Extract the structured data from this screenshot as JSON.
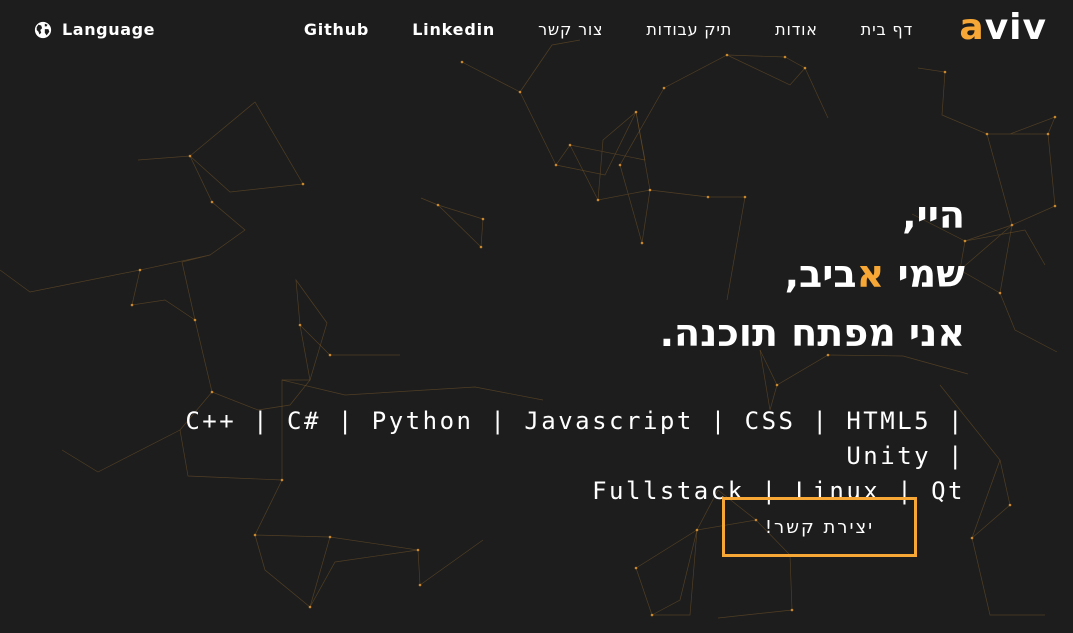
{
  "header": {
    "logo": {
      "accent": "a",
      "rest": "viv"
    },
    "nav": [
      {
        "label": "דף בית",
        "name": "nav-home"
      },
      {
        "label": "אודות",
        "name": "nav-about"
      },
      {
        "label": "תיק עבודות",
        "name": "nav-portfolio"
      },
      {
        "label": "צור קשר",
        "name": "nav-contact"
      },
      {
        "label": "Linkedin",
        "name": "nav-linkedin"
      },
      {
        "label": "Github",
        "name": "nav-github"
      }
    ],
    "language": {
      "label": "Language",
      "icon": "globe-icon"
    }
  },
  "hero": {
    "line1": "היי,",
    "line2_prefix": "שמי ",
    "line2_highlight": "א",
    "line2_suffix": "ביב,",
    "line3": "אני מפתח תוכנה.",
    "skills_line1": "C++ | C# | Python | Javascript | CSS | HTML5 | Unity |",
    "skills_line2": "Fullstack | Linux | Qt",
    "cta_label": "יצירת קשר!"
  },
  "colors": {
    "accent": "#f6a735",
    "background": "#1d1d1d",
    "text": "#ffffff"
  }
}
